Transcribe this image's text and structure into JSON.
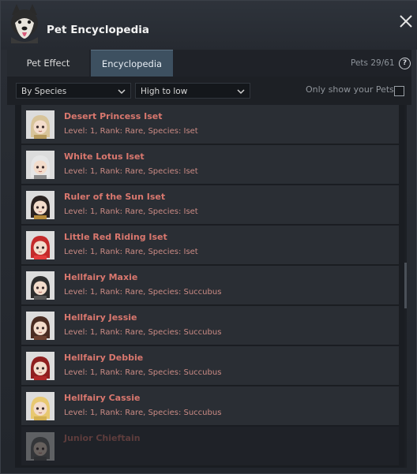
{
  "header": {
    "title": "Pet Encyclopedia"
  },
  "tabs": [
    {
      "label": "Pet Effect",
      "active": false
    },
    {
      "label": "Encyclopedia",
      "active": true
    }
  ],
  "pets_count": "Pets 29/61",
  "help_label": "?",
  "filters": {
    "species_select": "By Species",
    "order_select": "High to low",
    "only_show_label": "Only show your Pets",
    "only_show_checked": false
  },
  "pets": [
    {
      "name": "Desert Princess Iset",
      "desc": "Level: 1, Rank: Rare, Species: Iset",
      "icon": "iset-desert-icon",
      "hair": "#d8c49a",
      "accent": "#b79a5d"
    },
    {
      "name": "White Lotus Iset",
      "desc": "Level: 1, Rank: Rare, Species: Iset",
      "icon": "iset-lotus-icon",
      "hair": "#e6e6e6",
      "accent": "#8c8c8c"
    },
    {
      "name": "Ruler of the Sun Iset",
      "desc": "Level: 1, Rank: Rare, Species: Iset",
      "icon": "iset-sun-icon",
      "hair": "#2a2220",
      "accent": "#b58a3a"
    },
    {
      "name": "Little Red Riding Iset",
      "desc": "Level: 1, Rank: Rare, Species: Iset",
      "icon": "iset-red-icon",
      "hair": "#c42a2a",
      "accent": "#e33b3b"
    },
    {
      "name": "Hellfairy Maxie",
      "desc": "Level: 1, Rank: Rare, Species: Succubus",
      "icon": "succubus-maxie-icon",
      "hair": "#2d2d2d",
      "accent": "#555555"
    },
    {
      "name": "Hellfairy Jessie",
      "desc": "Level: 1, Rank: Rare, Species: Succubus",
      "icon": "succubus-jessie-icon",
      "hair": "#4a2c22",
      "accent": "#6b4030"
    },
    {
      "name": "Hellfairy Debbie",
      "desc": "Level: 1, Rank: Rare, Species: Succubus",
      "icon": "succubus-debbie-icon",
      "hair": "#8f1f1f",
      "accent": "#b02828"
    },
    {
      "name": "Hellfairy Cassie",
      "desc": "Level: 1, Rank: Rare, Species: Succubus",
      "icon": "succubus-cassie-icon",
      "hair": "#e8c870",
      "accent": "#d4b050"
    },
    {
      "name": "Junior Chieftain",
      "desc": "",
      "icon": "chieftain-icon",
      "hair": "#666666",
      "accent": "#555555"
    }
  ],
  "colors": {
    "accent_tab": "#3d5060",
    "pet_name": "#d9776e",
    "pet_desc": "#c98a84"
  }
}
